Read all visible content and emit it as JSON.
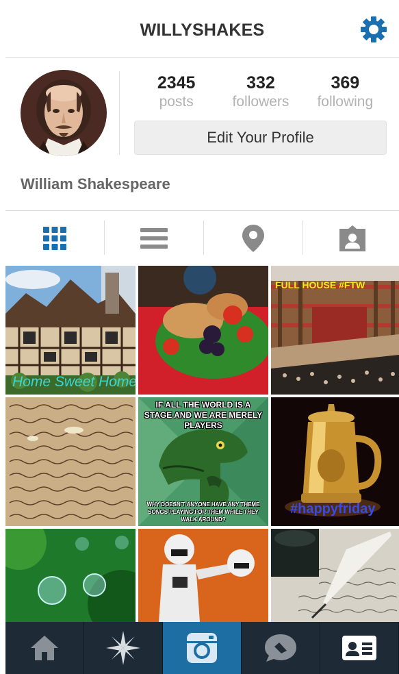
{
  "header": {
    "title": "WILLYSHAKES",
    "settings_icon": "gear-icon",
    "accent": "#1a6fb0"
  },
  "profile": {
    "full_name": "William Shakespeare",
    "stats": [
      {
        "value": "2345",
        "label": "posts"
      },
      {
        "value": "332",
        "label": "followers"
      },
      {
        "value": "369",
        "label": "following"
      }
    ],
    "edit_button": "Edit Your Profile"
  },
  "tabs": [
    {
      "icon": "grid-icon",
      "active": true
    },
    {
      "icon": "list-icon",
      "active": false
    },
    {
      "icon": "location-pin-icon",
      "active": false
    },
    {
      "icon": "tagged-person-icon",
      "active": false
    }
  ],
  "photos": [
    {
      "subject": "tudor-house",
      "caption": "Home Sweet Home"
    },
    {
      "subject": "food-platter",
      "caption": ""
    },
    {
      "subject": "globe-theatre",
      "caption": "FULL HOUSE #FTW"
    },
    {
      "subject": "handwritten-manuscript",
      "caption": ""
    },
    {
      "subject": "philosoraptor-meme",
      "caption_top": "IF ALL THE WORLD IS A STAGE AND WE ARE MERELY PLAYERS",
      "caption_bottom": "WHY DOESN'T ANYONE HAVE ANY THEME SONGS PLAYING FOR THEM WHILE THEY WALK AROUND?"
    },
    {
      "subject": "golden-tankard",
      "caption": "#happyfriday"
    },
    {
      "subject": "green-water-droplets",
      "caption": ""
    },
    {
      "subject": "stormtrooper-figures",
      "caption": ""
    },
    {
      "subject": "inkwell-quill",
      "caption": ""
    }
  ],
  "bottom_nav": [
    {
      "icon": "home-icon",
      "active": false
    },
    {
      "icon": "explore-star-icon",
      "active": false
    },
    {
      "icon": "camera-icon",
      "active": true
    },
    {
      "icon": "activity-bubble-icon",
      "active": false
    },
    {
      "icon": "profile-card-icon",
      "active": false
    }
  ]
}
